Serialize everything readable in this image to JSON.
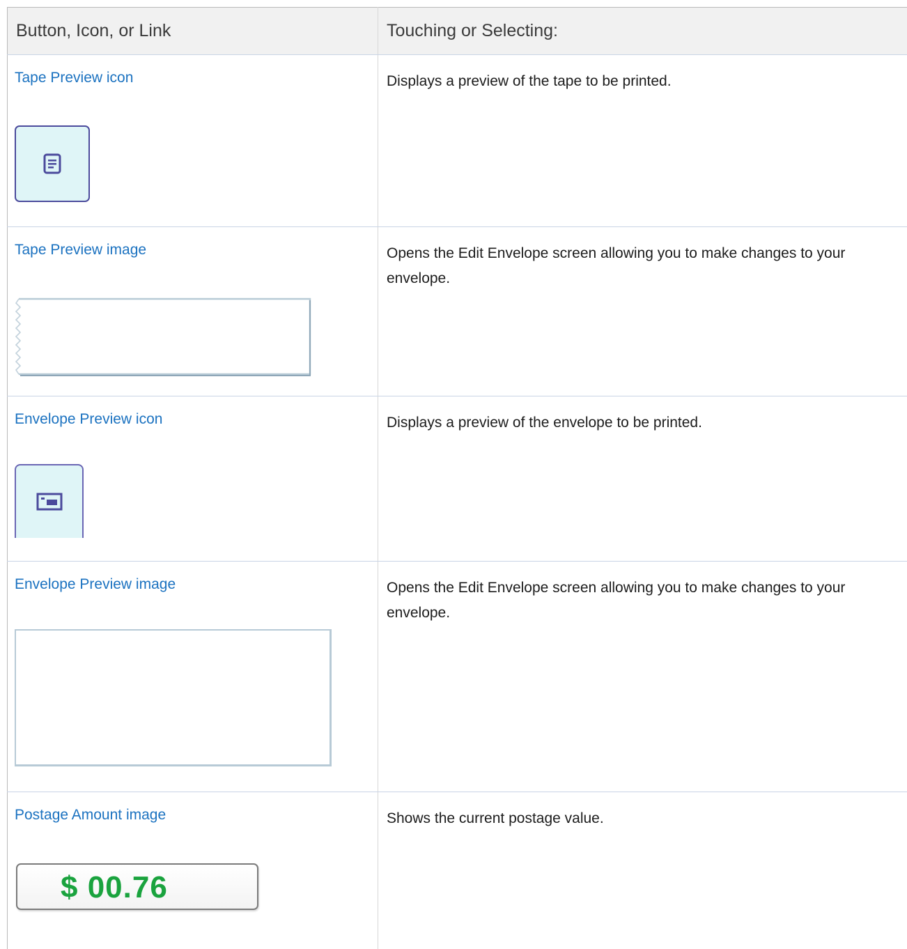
{
  "table": {
    "headers": {
      "col1": "Button, Icon, or Link",
      "col2": "Touching or Selecting:"
    },
    "rows": [
      {
        "name": "Tape Preview icon",
        "description": "Displays a preview of the tape to be printed.",
        "widget": "tape-preview-icon"
      },
      {
        "name": "Tape Preview image",
        "description": "Opens the Edit Envelope screen allowing you to make changes to your envelope.",
        "widget": "tape-preview-image"
      },
      {
        "name": "Envelope Preview icon",
        "description": "Displays a preview of the envelope to be printed.",
        "widget": "envelope-preview-icon"
      },
      {
        "name": "Envelope Preview image",
        "description": "Opens the Edit Envelope screen allowing you to make changes to your envelope.",
        "widget": "envelope-preview-image"
      },
      {
        "name": "Postage Amount image",
        "description": "Shows the current postage value.",
        "widget": "postage-amount",
        "postage_value": "$ 00.76"
      }
    ]
  },
  "colors": {
    "link": "#1b72c0",
    "postage_green": "#1aa33e",
    "icon_bg": "#dff5f7",
    "icon_border": "#4b4a9c"
  }
}
